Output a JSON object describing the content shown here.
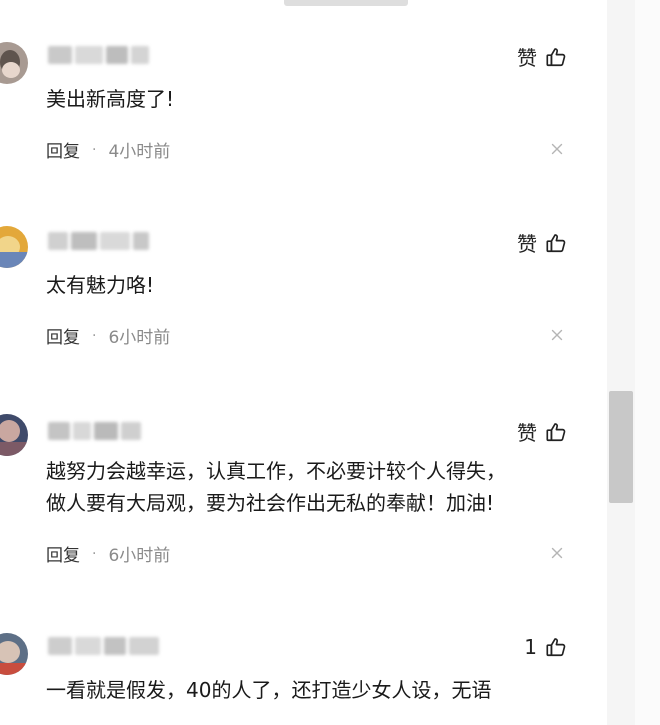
{
  "comments": [
    {
      "text": "美出新高度了!",
      "like_label": "赞",
      "reply_label": "回复",
      "separator": "·",
      "time": "4小时前"
    },
    {
      "text": "太有魅力咯!",
      "like_label": "赞",
      "reply_label": "回复",
      "separator": "·",
      "time": "6小时前"
    },
    {
      "text_line1": "越努力会越幸运，认真工作，不必要计较个人得失，",
      "text_line2": "做人要有大局观，要为社会作出无私的奉献！加油!",
      "like_label": "赞",
      "reply_label": "回复",
      "separator": "·",
      "time": "6小时前"
    },
    {
      "text": "一看就是假发，40的人了，还打造少女人设，无语",
      "like_label": "1"
    }
  ],
  "colors": {
    "scroll_thumb": "#c8c8c8",
    "time_text": "#8a8a8a",
    "close_icon": "#b5b5b5"
  }
}
